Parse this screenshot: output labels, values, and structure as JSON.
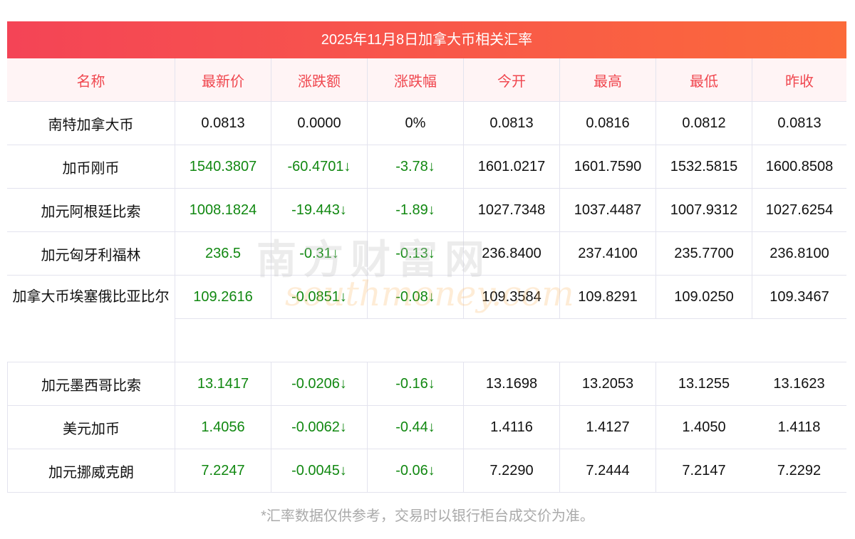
{
  "title": "2025年11月8日加拿大币相关汇率",
  "headers": [
    "名称",
    "最新价",
    "涨跌额",
    "涨跌幅",
    "今开",
    "最高",
    "最低",
    "昨收"
  ],
  "rows": [
    [
      "南特加拿大币",
      "0.0813",
      "0.0000",
      "0%",
      "0.0813",
      "0.0816",
      "0.0812",
      "0.0813"
    ],
    [
      "加币刚币",
      "1540.3807",
      "-60.4701↓",
      "-3.78↓",
      "1601.0217",
      "1601.7590",
      "1532.5815",
      "1600.8508"
    ],
    [
      "加元阿根廷比索",
      "1008.1824",
      "-19.443↓",
      "-1.89↓",
      "1027.7348",
      "1037.4487",
      "1007.9312",
      "1027.6254"
    ],
    [
      "加元匈牙利福林",
      "236.5",
      "-0.31↓",
      "-0.13↓",
      "236.8400",
      "237.4100",
      "235.7700",
      "236.8100"
    ],
    [
      "加拿大币埃塞俄比亚比尔",
      "109.2616",
      "-0.0851↓",
      "-0.08↓",
      "109.3584",
      "109.8291",
      "109.0250",
      "109.3467"
    ],
    [
      "加元墨西哥比索",
      "13.1417",
      "-0.0206↓",
      "-0.16↓",
      "13.1698",
      "13.2053",
      "13.1255",
      "13.1623"
    ],
    [
      "美元加币",
      "1.4056",
      "-0.0062↓",
      "-0.44↓",
      "1.4116",
      "1.4127",
      "1.4050",
      "1.4118"
    ],
    [
      "加元挪威克朗",
      "7.2247",
      "-0.0045↓",
      "-0.06↓",
      "7.2290",
      "7.2444",
      "7.2147",
      "7.2292"
    ]
  ],
  "watermark": {
    "cn": "南方财富网",
    "en": "southmoney.com"
  },
  "footnote": "*汇率数据仅供参考，交易时以银行柜台成交价为准。"
}
